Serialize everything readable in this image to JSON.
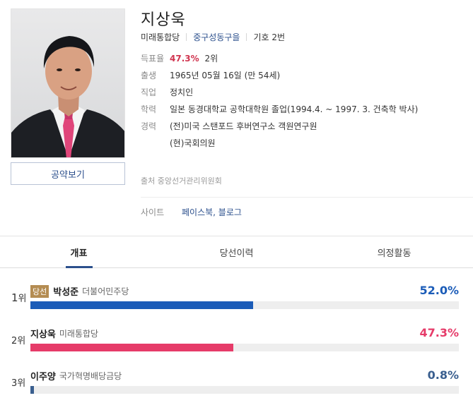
{
  "profile": {
    "name": "지상욱",
    "party": "미래통합당",
    "district": "중구성동구을",
    "number": "기호 2번",
    "pledge_button": "공약보기",
    "source": "출처 중앙선거관리위원회"
  },
  "info": {
    "vote_rate": {
      "label": "득표율",
      "percent": "47.3%",
      "rank": "2위"
    },
    "birth": {
      "label": "출생",
      "value": "1965년 05월 16일 (만 54세)"
    },
    "job": {
      "label": "직업",
      "value": "정치인"
    },
    "education": {
      "label": "학력",
      "value": "일본 동경대학교 공학대학원 졸업(1994.4. ~ 1997. 3. 건축학 박사)"
    },
    "career": {
      "label": "경력",
      "items": [
        "(전)미국 스탠포드 후버연구소 객원연구원",
        "(현)국회의원"
      ]
    }
  },
  "site": {
    "label": "사이트",
    "links": "페이스북, 블로그"
  },
  "tabs": [
    "개표",
    "당선이력",
    "의정활동"
  ],
  "results": [
    {
      "rank": "1",
      "rank_suffix": "위",
      "badge": "당선",
      "name": "박성준",
      "party": "더불어민주당",
      "rate": "52.0%",
      "value": 52.0,
      "color": "#1b5cb8"
    },
    {
      "rank": "2",
      "rank_suffix": "위",
      "badge": "",
      "name": "지상욱",
      "party": "미래통합당",
      "rate": "47.3%",
      "value": 47.3,
      "color": "#e63b69"
    },
    {
      "rank": "3",
      "rank_suffix": "위",
      "badge": "",
      "name": "이주양",
      "party": "국가혁명배당금당",
      "rate": "0.8%",
      "value": 0.8,
      "color": "#3a5f8f"
    }
  ],
  "colors": {
    "accent": "#2b4f8c",
    "win": "#1b5cb8",
    "lose": "#e63b69",
    "badge": "#b48c52"
  }
}
